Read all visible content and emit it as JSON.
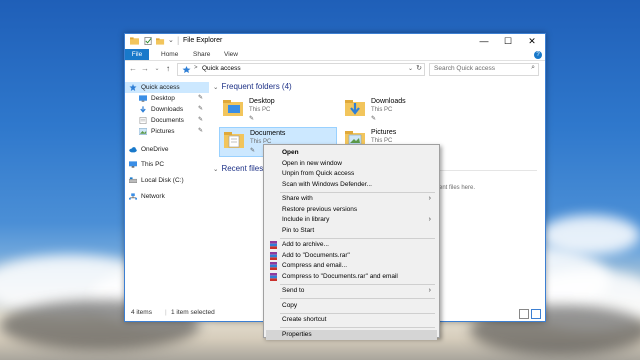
{
  "window": {
    "title": "File Explorer",
    "controls": {
      "minimize": "—",
      "maximize": "☐",
      "close": "✕"
    }
  },
  "ribbon": {
    "tabs": [
      "File",
      "Home",
      "Share",
      "View"
    ],
    "help": "?"
  },
  "navigation": {
    "back": "←",
    "forward": "→",
    "up": "↑",
    "dropdown": "⌄",
    "breadcrumb": "Quick access",
    "breadcrumb_sep": ">",
    "address_dropdown": "⌄",
    "refresh": "↻",
    "search_placeholder": "Search Quick access",
    "search_icon": "⌕"
  },
  "sidebar": {
    "items": [
      {
        "label": "Quick access",
        "icon": "star-icon",
        "pinned": false
      },
      {
        "label": "Desktop",
        "icon": "desktop-folder-icon",
        "pinned": true
      },
      {
        "label": "Downloads",
        "icon": "downloads-folder-icon",
        "pinned": true
      },
      {
        "label": "Documents",
        "icon": "documents-folder-icon",
        "pinned": true
      },
      {
        "label": "Pictures",
        "icon": "pictures-folder-icon",
        "pinned": true
      },
      {
        "label": "OneDrive",
        "icon": "onedrive-icon",
        "pinned": false
      },
      {
        "label": "This PC",
        "icon": "computer-icon",
        "pinned": false
      },
      {
        "label": "Local Disk (C:)",
        "icon": "disk-icon",
        "pinned": false
      },
      {
        "label": "Network",
        "icon": "network-icon",
        "pinned": false
      }
    ],
    "pin_glyph": "✎"
  },
  "content": {
    "frequent_header": "Frequent folders (4)",
    "recent_header": "Recent files",
    "chevron": "⌄",
    "folders": [
      {
        "name": "Desktop",
        "location": "This PC",
        "pin": "✎"
      },
      {
        "name": "Downloads",
        "location": "This PC",
        "pin": "✎"
      },
      {
        "name": "Documents",
        "location": "This PC",
        "pin": "✎"
      },
      {
        "name": "Pictures",
        "location": "This PC",
        "pin": "✎"
      }
    ],
    "recent_hint": "ent files here."
  },
  "status": {
    "items": "4 items",
    "selected": "1 item selected"
  },
  "context_menu": {
    "items": [
      {
        "label": "Open",
        "bold": true,
        "submenu": false
      },
      {
        "label": "Open in new window",
        "submenu": false
      },
      {
        "label": "Unpin from Quick access",
        "submenu": false
      },
      {
        "label": "Scan with Windows Defender...",
        "submenu": false
      },
      {
        "label": "Share with",
        "submenu": true
      },
      {
        "label": "Restore previous versions",
        "submenu": false
      },
      {
        "label": "Include in library",
        "submenu": true
      },
      {
        "label": "Pin to Start",
        "submenu": false
      },
      {
        "label": "Add to archive...",
        "submenu": false,
        "rar": true
      },
      {
        "label": "Add to \"Documents.rar\"",
        "submenu": false,
        "rar": true
      },
      {
        "label": "Compress and email...",
        "submenu": false,
        "rar": true
      },
      {
        "label": "Compress to \"Documents.rar\" and email",
        "submenu": false,
        "rar": true
      },
      {
        "label": "Send to",
        "submenu": true
      },
      {
        "label": "Copy",
        "submenu": false
      },
      {
        "label": "Create shortcut",
        "submenu": false
      },
      {
        "label": "Properties",
        "submenu": false,
        "highlighted": true
      }
    ],
    "submenu_arrow": "›"
  },
  "colors": {
    "accent": "#1979ca",
    "selection": "#cce8ff",
    "folder": "#f2c55c",
    "header_text": "#1e3287"
  }
}
